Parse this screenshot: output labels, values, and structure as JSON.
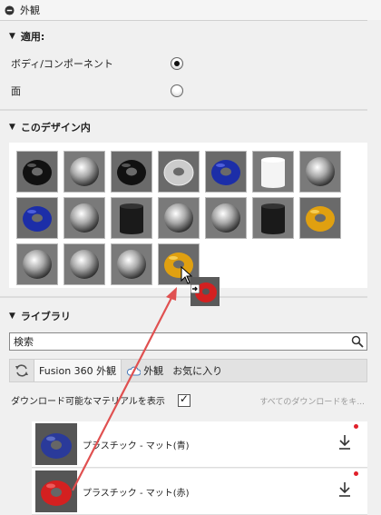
{
  "panel": {
    "title": "外観"
  },
  "apply": {
    "header": "適用:",
    "options": [
      {
        "label": "ボディ/コンポーネント",
        "selected": true
      },
      {
        "label": "面",
        "selected": false
      }
    ]
  },
  "in_design": {
    "header": "このデザイン内",
    "swatches": [
      "black-torus",
      "chrome-sphere",
      "black-torus",
      "chrome-torus",
      "blue-torus",
      "white-cylinder",
      "chrome-sphere",
      "blue-torus",
      "chrome-sphere",
      "black-cylinder",
      "chrome-sphere",
      "chrome-sphere",
      "black-cylinder",
      "gold-torus",
      "chrome-sphere",
      "chrome-sphere",
      "chrome-sphere",
      "gold-torus"
    ]
  },
  "library": {
    "header": "ライブラリ",
    "search": {
      "value": "検索"
    },
    "tabs": [
      {
        "label": "Fusion 360 外観",
        "icon": "refresh-icon"
      },
      {
        "label": "外観",
        "icon": "cloud-icon"
      },
      {
        "label": "お気に入り"
      }
    ],
    "show_downloadable": {
      "label": "ダウンロード可能なマテリアルを表示",
      "checked": true
    },
    "download_all": "すべてのダウンロードをキ...",
    "materials": [
      {
        "name": "プラスチック - マット(青)",
        "color": "#2a3a9a"
      },
      {
        "name": "プラスチック - マット(赤)",
        "color": "#d42020"
      }
    ]
  },
  "colors": {
    "accent_red": "#e0202a",
    "drag_arrow": "#e05050"
  }
}
